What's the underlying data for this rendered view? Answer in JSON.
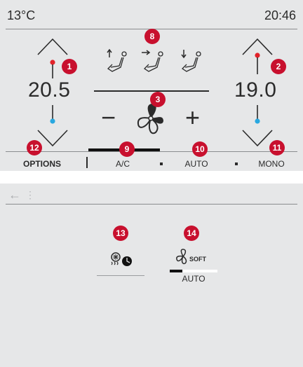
{
  "status": {
    "outside_temp": "13°C",
    "clock": "20:46"
  },
  "left_zone": {
    "temperature": "20.5"
  },
  "right_zone": {
    "temperature": "19.0"
  },
  "fan": {
    "decrease_symbol": "−",
    "increase_symbol": "+"
  },
  "airflow_modes": [
    "upper-airflow-icon",
    "middle-airflow-icon",
    "lower-airflow-icon"
  ],
  "bottom_bar": {
    "options": "OPTIONS",
    "ac": "A/C",
    "auto": "AUTO",
    "mono": "MONO"
  },
  "secondary_screen": {
    "back_symbol": "←",
    "menu_symbol": "⋮",
    "soft_label": "SOFT",
    "auto_label": "AUTO"
  },
  "callouts": {
    "c1": "1",
    "c2": "2",
    "c3": "3",
    "c8": "8",
    "c9": "9",
    "c10": "10",
    "c11": "11",
    "c12": "12",
    "c13": "13",
    "c14": "14"
  },
  "colors": {
    "badge": "#c8102e",
    "hot": "#e2232a",
    "cold": "#29a8e0",
    "panel": "#e6e7e8"
  }
}
